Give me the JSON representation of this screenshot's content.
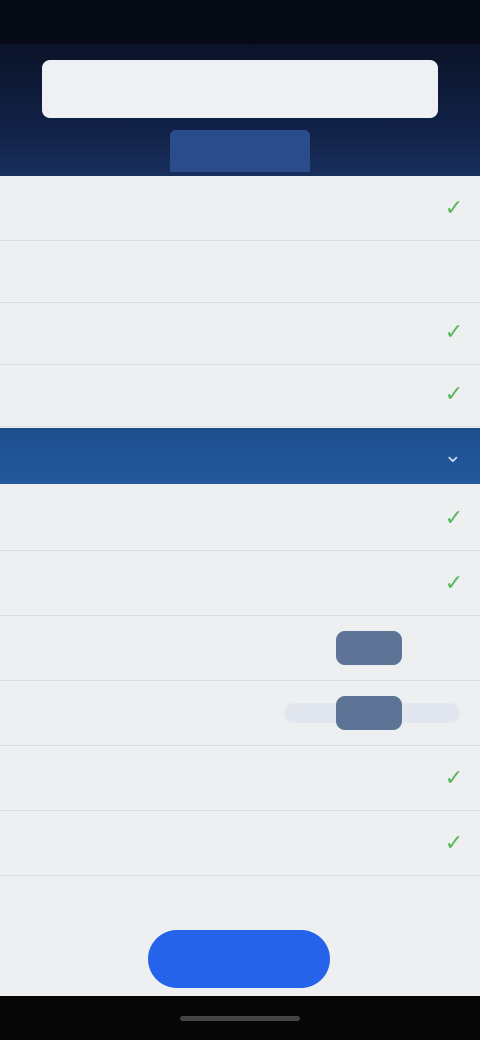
{
  "status_bar": {
    "time": ""
  },
  "header": {
    "search_placeholder": "",
    "active_tab": ""
  },
  "group1": {
    "rows": [
      {
        "label": "",
        "checked": true
      },
      {
        "label": "",
        "checked": false
      },
      {
        "label": "",
        "checked": true
      },
      {
        "label": "",
        "checked": true
      }
    ]
  },
  "section2": {
    "title": "",
    "rows": [
      {
        "label": "",
        "control": "check"
      },
      {
        "label": "",
        "control": "check"
      },
      {
        "label": "",
        "control": "pill",
        "pill_label": ""
      },
      {
        "label": "",
        "control": "pill",
        "pill_label": ""
      },
      {
        "label": "",
        "control": "check"
      },
      {
        "label": "",
        "control": "check"
      },
      {
        "label": "",
        "control": "none"
      }
    ]
  },
  "fab_label": "",
  "colors": {
    "accent": "#2563eb",
    "section": "#24599c",
    "check": "#56b85a"
  },
  "icons": {
    "check": "checkmark-icon",
    "chevron": "chevron-down-icon"
  }
}
